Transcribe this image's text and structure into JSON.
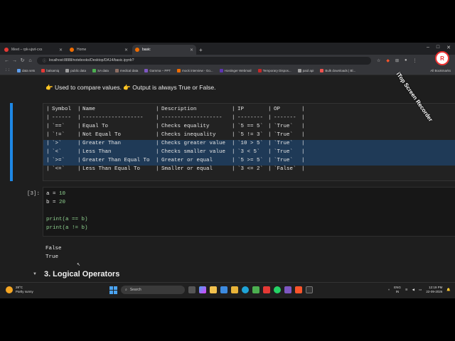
{
  "browser": {
    "tabs": [
      {
        "label": "Meet – rpk-ujwt-cxs",
        "color": "#e53935",
        "active": false
      },
      {
        "label": "Home",
        "color": "#ef6c00",
        "active": false
      },
      {
        "label": "basic",
        "color": "#ef6c00",
        "active": true
      }
    ],
    "new_tab": "+",
    "url": "localhost:8888/notebooks/Desktop/DA14/basic.ipynb?",
    "bookmarks": [
      {
        "label": "data sets",
        "color": "#5c9ded"
      },
      {
        "label": "balsamiq",
        "color": "#e53935"
      },
      {
        "label": "public data",
        "color": "#9e9e9e"
      },
      {
        "label": "SA data",
        "color": "#4caf50"
      },
      {
        "label": "medical data",
        "color": "#8d6e63"
      },
      {
        "label": "Gamma – PPT",
        "color": "#7e57c2"
      },
      {
        "label": "mock interview - Go...",
        "color": "#ef6c00"
      },
      {
        "label": "Hostinger Webmail",
        "color": "#5e35b1"
      },
      {
        "label": "Temporary Dispos...",
        "color": "#c62828"
      },
      {
        "label": "paid api",
        "color": "#9e9e9e"
      },
      {
        "label": "Bulk downloads | Bl...",
        "color": "#ef5350"
      }
    ],
    "all_bookmarks": "All Bookmarks"
  },
  "watermark": {
    "text": "iTop Screen Recorder",
    "logo": "R"
  },
  "notebook": {
    "intro": "👉 Used to compare values. 👉 Output is always True or False.",
    "table": {
      "header": [
        "Symbol",
        "Name",
        "Description",
        "IP",
        "OP"
      ],
      "separator": [
        "------",
        "-------------------",
        "-------------------",
        "--------",
        "-------"
      ],
      "rows": [
        [
          "`==`",
          "Equal To",
          "Checks equality",
          "`5 == 5`",
          "`True`"
        ],
        [
          "`!=`",
          "Not Equal To",
          "Checks inequality",
          "`5 != 3`",
          "`True`"
        ],
        [
          "`>`",
          "Greater Than",
          "Checks greater value",
          "`10 > 5`",
          "`True`"
        ],
        [
          "`<`",
          "Less Than",
          "Checks smaller value",
          "`3 < 5`",
          "`True`"
        ],
        [
          "`>=`",
          "Greater Than Equal To",
          "Greater or equal",
          "`5 >= 5`",
          "`True`"
        ],
        [
          "`<=`",
          "Less Than Equal To",
          "Smaller or equal",
          "`3 <= 2`",
          "`False`"
        ]
      ]
    },
    "code_prompt": "[3]:",
    "code": {
      "l1_var": "a",
      "l1_op": " = ",
      "l1_val": "10",
      "l2_var": "b",
      "l2_op": " = ",
      "l2_val": "20",
      "l3": "print(a == b)",
      "l4": "print(a != b)"
    },
    "outputs": [
      "False",
      "True"
    ],
    "section_title": "3. Logical Operators"
  },
  "taskbar": {
    "weather_temp": "28°C",
    "weather_desc": "Partly sunny",
    "search": "Search",
    "lang1": "ENG",
    "lang2": "IN",
    "time": "12:19 PM",
    "date": "22-09-2026"
  }
}
